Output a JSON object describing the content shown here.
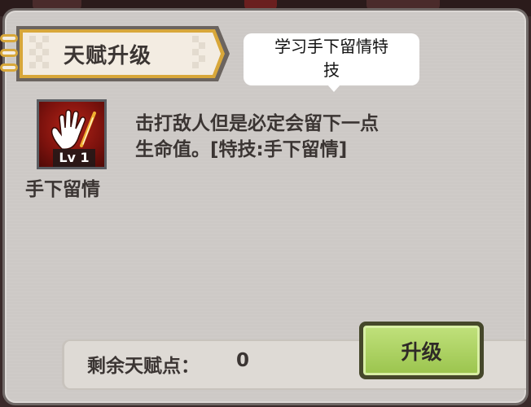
{
  "dialog": {
    "title": "天赋升级",
    "tooltip_line1": "学习手下留情特",
    "tooltip_line2": "技"
  },
  "skill": {
    "icon": "open-hand-icon",
    "level_badge": "Lv 1",
    "name": "手下留情",
    "description_line1": "击打敌人但是必定会留下一点",
    "description_line2": "生命值。[特技:手下留情]"
  },
  "footer": {
    "points_label": "剩余天赋点：",
    "points_value": "0",
    "upgrade_label": "升级"
  },
  "colors": {
    "panel": "#cdc9c6",
    "banner_border": "#d8a73a",
    "icon_background": "#9a1a12",
    "button_green": "#a8cc5c"
  }
}
